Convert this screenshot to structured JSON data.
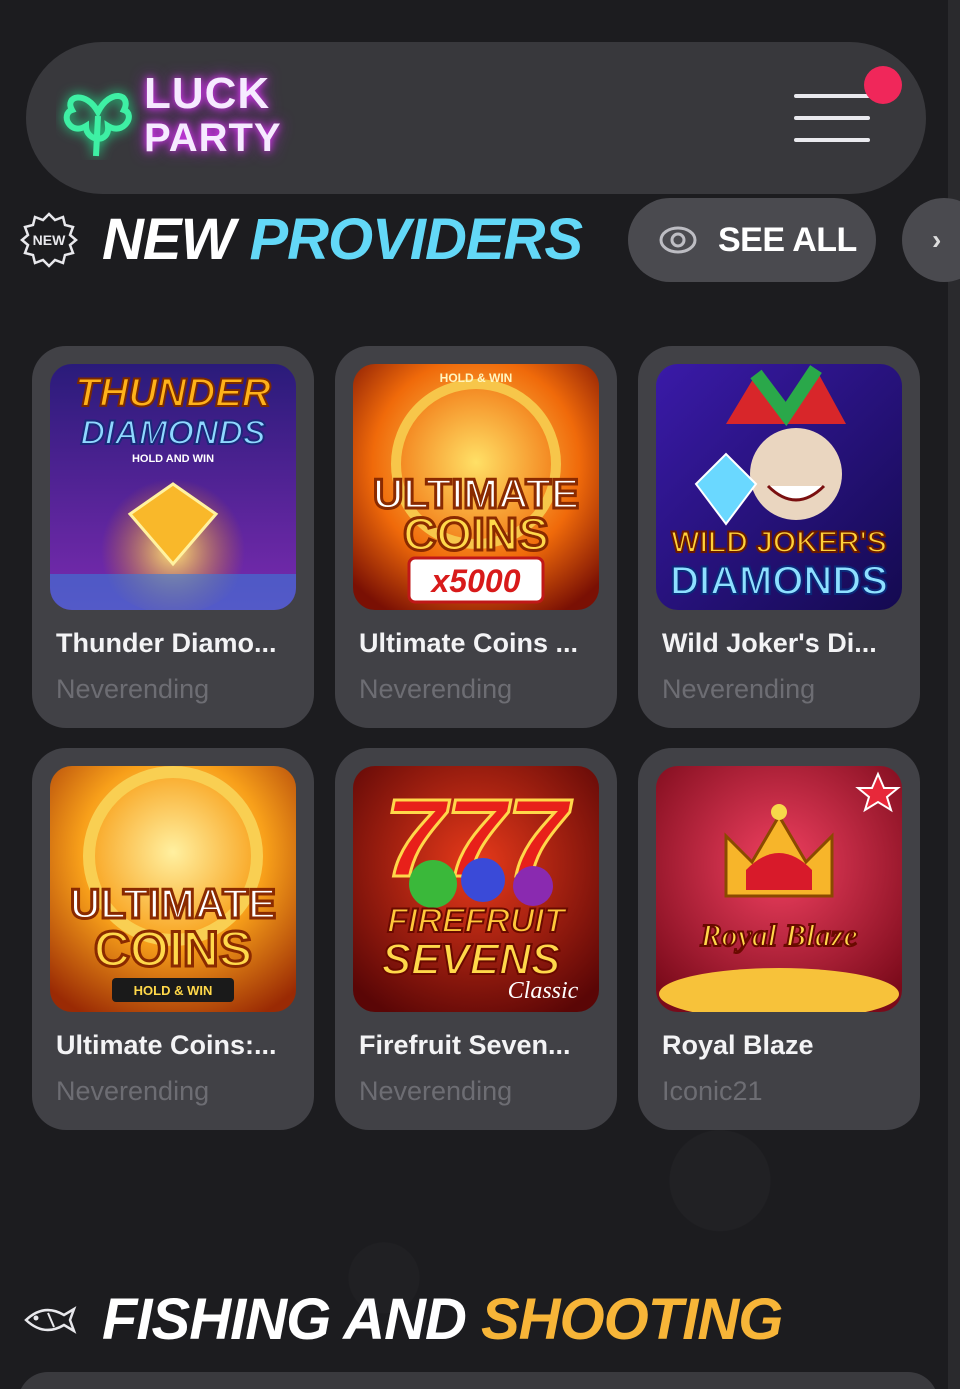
{
  "brand": {
    "line1": "LUCK",
    "line2": "PARTY"
  },
  "sections": {
    "new_providers": {
      "title_word1": "NEW",
      "title_word2": "PROVIDERS",
      "see_all": "SEE ALL",
      "badge": "NEW"
    },
    "fishing": {
      "title_word1": "FISHING AND",
      "title_word2": "SHOOTING"
    }
  },
  "games": [
    {
      "title": "Thunder Diamo...",
      "provider": "Neverending",
      "art": {
        "line1": "THUNDER",
        "line2": "DIAMONDS",
        "line3": "HOLD AND WIN"
      }
    },
    {
      "title": "Ultimate Coins ...",
      "provider": "Neverending",
      "art": {
        "line0": "HOLD & WIN",
        "line1": "ULTIMATE",
        "line2": "COINS",
        "line3": "x5000"
      }
    },
    {
      "title": "Wild Joker's Di...",
      "provider": "Neverending",
      "art": {
        "line1": "WILD JOKER'S",
        "line2": "DIAMONDS"
      }
    },
    {
      "title": "Ultimate Coins:...",
      "provider": "Neverending",
      "art": {
        "line1": "ULTIMATE",
        "line2": "COINS",
        "line3": "HOLD & WIN"
      }
    },
    {
      "title": "Firefruit Seven...",
      "provider": "Neverending",
      "art": {
        "line0": "777",
        "line1": "FIREFRUIT",
        "line2": "SEVENS",
        "line3": "Classic"
      }
    },
    {
      "title": "Royal Blaze",
      "provider": "Iconic21",
      "art": {
        "line1": "Royal Blaze"
      }
    }
  ]
}
